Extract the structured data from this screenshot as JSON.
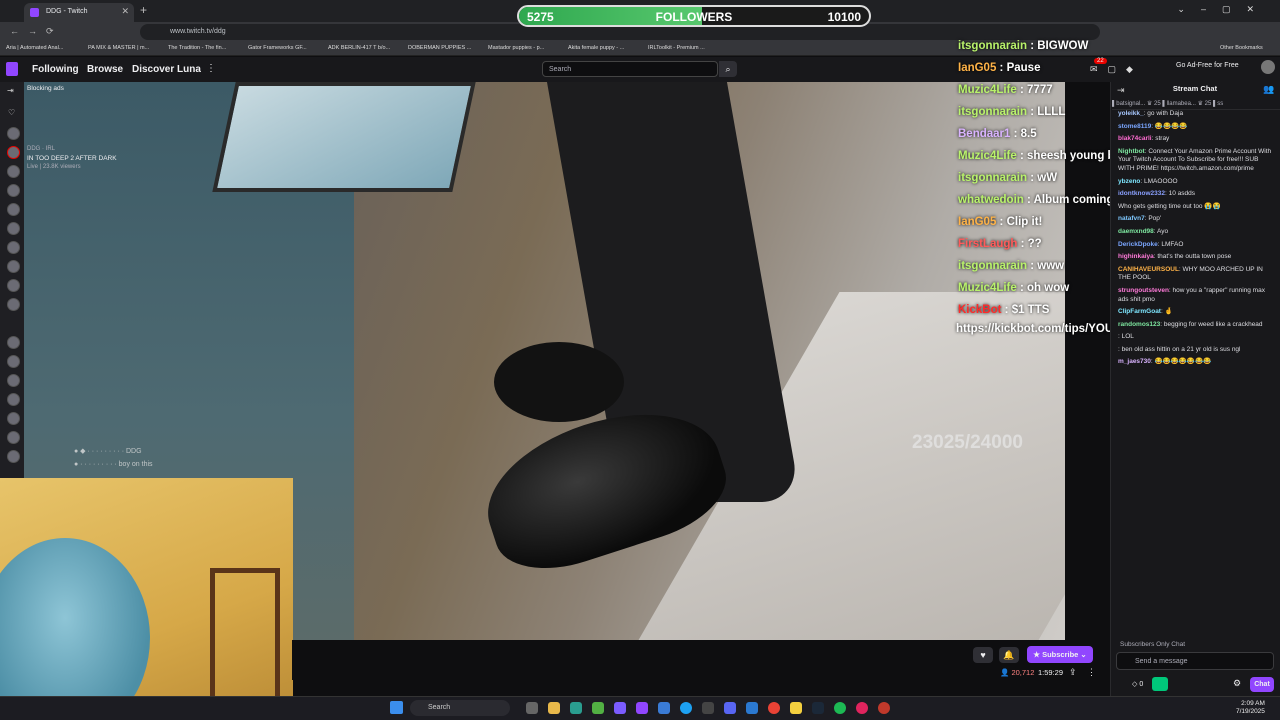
{
  "browser": {
    "tab_title": "DDG - Twitch",
    "url": "www.twitch.tv/ddg",
    "bookmarks": [
      "Aria | Automated Anal...",
      "PA MIX & MASTER | m...",
      "The Tradition - The fin...",
      "Gator Frameworks GF...",
      "ADK BERLIN-417 T b/o...",
      "DOBERMAN PUPPIES ...",
      "Mastador puppies - p...",
      "Akita female puppy - ...",
      "IRLToolkit - Premium ...",
      "Other Bookmarks"
    ]
  },
  "twitch_nav": {
    "following": "Following",
    "browse": "Browse",
    "discover": "Discover Luna",
    "search_placeholder": "Search",
    "notifications_count": "22",
    "ad_free": "Go Ad-Free for Free"
  },
  "sidebar": {
    "blocking_ads": "Blocking ads",
    "card_category": "DDG · IRL",
    "card_title": "IN TOO DEEP 2 AFTER DARK",
    "card_viewers": "Live | 23.8K viewers"
  },
  "followers_goal": {
    "label": "FOLLOWERS",
    "current": "5275",
    "goal": "10100",
    "progress_fraction": 0.522
  },
  "overlay_chat": [
    {
      "user": "itsgonnarain",
      "msg": "BIGWOW",
      "color": "#b9f36b"
    },
    {
      "user": "IanG05",
      "msg": "Pause",
      "color": "#ffb347"
    },
    {
      "user": "Muzic4Life",
      "msg": "7777",
      "color": "#b9f36b"
    },
    {
      "user": "itsgonnarain",
      "msg": "LLLL",
      "color": "#b9f36b"
    },
    {
      "user": "Bendaar1",
      "msg": "8.5",
      "color": "#d9b3ff"
    },
    {
      "user": "Muzic4Life",
      "msg": "sheesh young be grinding",
      "color": "#b9f36b"
    },
    {
      "user": "itsgonnarain",
      "msg": "wW",
      "color": "#b9f36b"
    },
    {
      "user": "whatwedoin",
      "msg": "Album coming soon?",
      "color": "#b9f36b"
    },
    {
      "user": "IanG05",
      "msg": "Clip it!",
      "color": "#ffb347"
    },
    {
      "user": "FirstLaugh",
      "msg": "??",
      "color": "#ff5a5a"
    },
    {
      "user": "itsgonnarain",
      "msg": "www",
      "color": "#b9f36b"
    },
    {
      "user": "Muzic4Life",
      "msg": "oh wow",
      "color": "#b9f36b"
    },
    {
      "user": "KickBot",
      "msg": "$1 TTS",
      "color": "#ff2a2a"
    }
  ],
  "overlay_link": "https://kickbot.com/tips/YOUNGMAKESMUSIC",
  "video_counter": "23025/24000",
  "player": {
    "subscribe": "Subscribe",
    "viewers": "20,712",
    "uptime": "1:59:29"
  },
  "chat_panel": {
    "title": "Stream Chat",
    "rows": [
      {
        "user": "yoleikk_",
        "msg": ": go with Daja",
        "color": "#a8c8ff"
      },
      {
        "user": "stome8119",
        "msg": ": 😂😂😂😂",
        "color": "#7aa6ff"
      },
      {
        "user": "blak74carli",
        "msg": ": stray",
        "color": "#ff6bd1"
      },
      {
        "user": "Nightbot",
        "msg": ": Connect Your Amazon Prime Account With Your Twitch Account To Subscribe for free!!! SUB WITH PRIME! https://twitch.amazon.com/prime",
        "color": "#7ee7a0"
      },
      {
        "user": "ybzeno",
        "msg": ": LMAOOOO",
        "color": "#7ee7ff"
      },
      {
        "user": "idontknow2332",
        "msg": ": 10 asdds",
        "color": "#8aa0ff"
      },
      {
        "user": "",
        "msg": "Who gets getting time out too 😭😭",
        "color": "#ff5a5a"
      },
      {
        "user": "natafvn7",
        "msg": ": Pop'",
        "color": "#7ec8ff"
      },
      {
        "user": "daemxnd98",
        "msg": ": Ayo",
        "color": "#7ee7a0"
      },
      {
        "user": "DerickDpoke",
        "msg": ": LMFAO",
        "color": "#7aa6ff"
      },
      {
        "user": "highinkaiya",
        "msg": ": that's the outta town pose",
        "color": "#ff7ad9"
      },
      {
        "user": "CANIHAVEURSOUL",
        "msg": ": WHY MOO ARCHED UP IN THE POOL",
        "color": "#ffb347"
      },
      {
        "user": "strungoutsteven",
        "msg": ": how you a \"rapper\" running max ads shit pmo",
        "color": "#ff7ad9"
      },
      {
        "user": "ClipFarmGoat",
        "msg": ": 🤞",
        "color": "#7ee7ff"
      },
      {
        "user": "randomos123",
        "msg": ": begging for weed like a crackhead",
        "color": "#7ee7a0"
      },
      {
        "user": "",
        "msg": ": LOL",
        "color": "#ff5a5a"
      },
      {
        "user": "",
        "msg": ": ben old ass hittin on a 21 yr old is sus ngl",
        "color": "#b98aff"
      },
      {
        "user": "m_jaes730",
        "msg": ": 😂😂😂😂😂😂😂",
        "color": "#d9b3ff"
      }
    ],
    "subscribers_only": "Subscribers Only Chat",
    "placeholder": "Send a message",
    "points": "0",
    "chat_button": "Chat"
  },
  "taskbar": {
    "search": "Search",
    "time": "2:09 AM",
    "date": "7/19/2025"
  }
}
